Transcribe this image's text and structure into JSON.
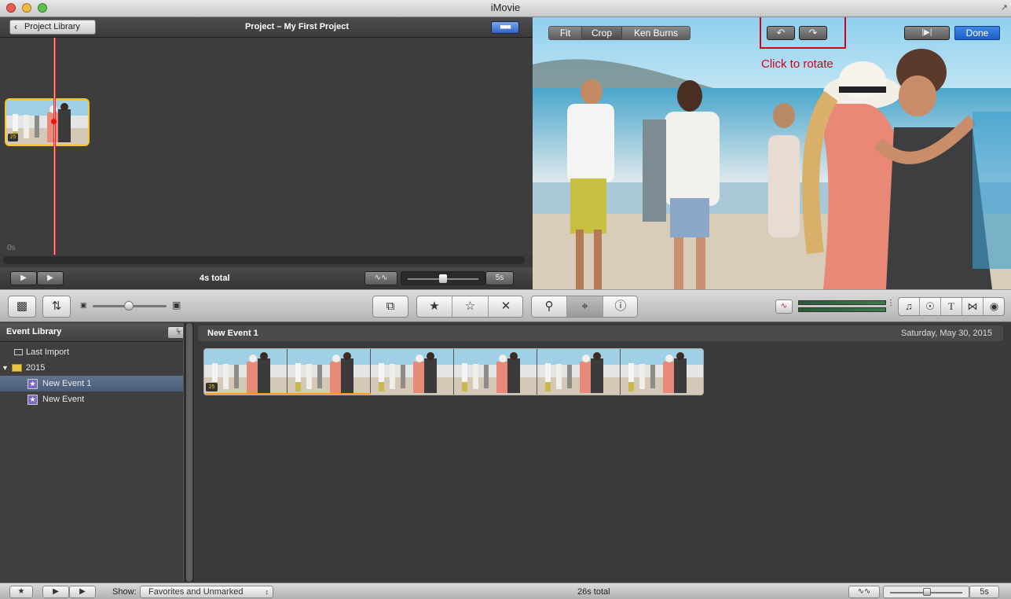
{
  "window": {
    "title": "iMovie"
  },
  "project": {
    "back_label": "Project Library",
    "title": "Project – My First Project",
    "clip_badge": "25",
    "time_label": "0s",
    "total": "4s total",
    "zoom_value": "5s"
  },
  "viewer": {
    "tabs": [
      "Fit",
      "Crop",
      "Ken Burns"
    ],
    "active_tab": "Crop",
    "done_label": "Done",
    "annotation": "Click to rotate",
    "annotation_color": "#d0021b"
  },
  "toolbar": {
    "favorite_icon": "star-icon",
    "unmark_icon": "empty-star-icon",
    "reject_icon": "x-icon",
    "voiceover_icon": "microphone-icon",
    "crop_icon": "crop-icon",
    "info_icon": "info-icon",
    "accent": "#2f6fd6"
  },
  "library": {
    "title": "Event Library",
    "items": [
      {
        "label": "Last Import",
        "level": 1
      },
      {
        "label": "2015",
        "level": 0
      },
      {
        "label": "New Event 1",
        "level": 2,
        "selected": true
      },
      {
        "label": "New Event",
        "level": 2
      }
    ]
  },
  "event": {
    "name": "New Event 1",
    "date": "Saturday, May 30, 2015",
    "clip_badge": "25"
  },
  "bottom": {
    "show_label": "Show:",
    "filter_value": "Favorites and Unmarked",
    "total": "26s total",
    "zoom_value": "5s"
  }
}
